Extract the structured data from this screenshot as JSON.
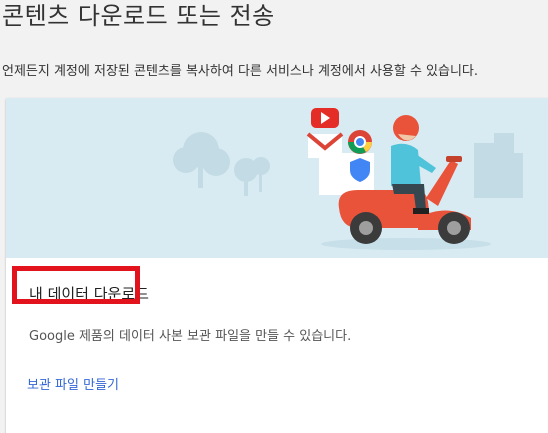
{
  "page": {
    "title": "콘텐츠 다운로드 또는 전송",
    "description": "언제든지 계정에 저장된 콘텐츠를 복사하여 다른 서비스나 계정에서 사용할 수 있습니다."
  },
  "card": {
    "illustration": "person-on-scooter-with-google-apps-icons",
    "title": "내 데이터 다운로드",
    "description": "Google 제품의 데이터 사본 보관 파일을 만들 수 있습니다.",
    "create_link_label": "보관 파일 만들기"
  },
  "annotation": {
    "highlight_color": "#e3131e"
  },
  "colors": {
    "hero_bg": "#d9ebf2",
    "scooter": "#e8533a",
    "link": "#3367d6"
  }
}
